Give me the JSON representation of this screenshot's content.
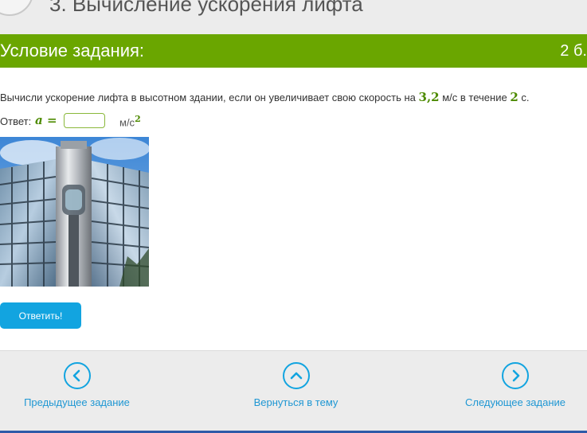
{
  "header": {
    "title": "3. Вычисление ускорения лифта"
  },
  "condition_bar": {
    "title": "Условие задания:",
    "points": "2 б."
  },
  "task": {
    "text_before_speed": "Вычисли ускорение лифта в высотном здании, если он увеличивает свою скорость на ",
    "speed_value": "3,2",
    "text_between": " м/с в течение ",
    "time_value": "2",
    "text_after_time": " с."
  },
  "answer": {
    "label": "Ответ: ",
    "variable": "a =",
    "input_value": "",
    "unit": "м/с",
    "unit_exponent": "2"
  },
  "submit_button": {
    "label": "Ответить!",
    "color": "#12a4e0"
  },
  "footer": {
    "prev_label": "Предыдущее задание",
    "back_label": "Вернуться в тему",
    "next_label": "Следующее задание",
    "link_color": "#1f97d3"
  },
  "colors": {
    "condition_bar": "#6aa600",
    "math_accent": "#4d8a00"
  }
}
